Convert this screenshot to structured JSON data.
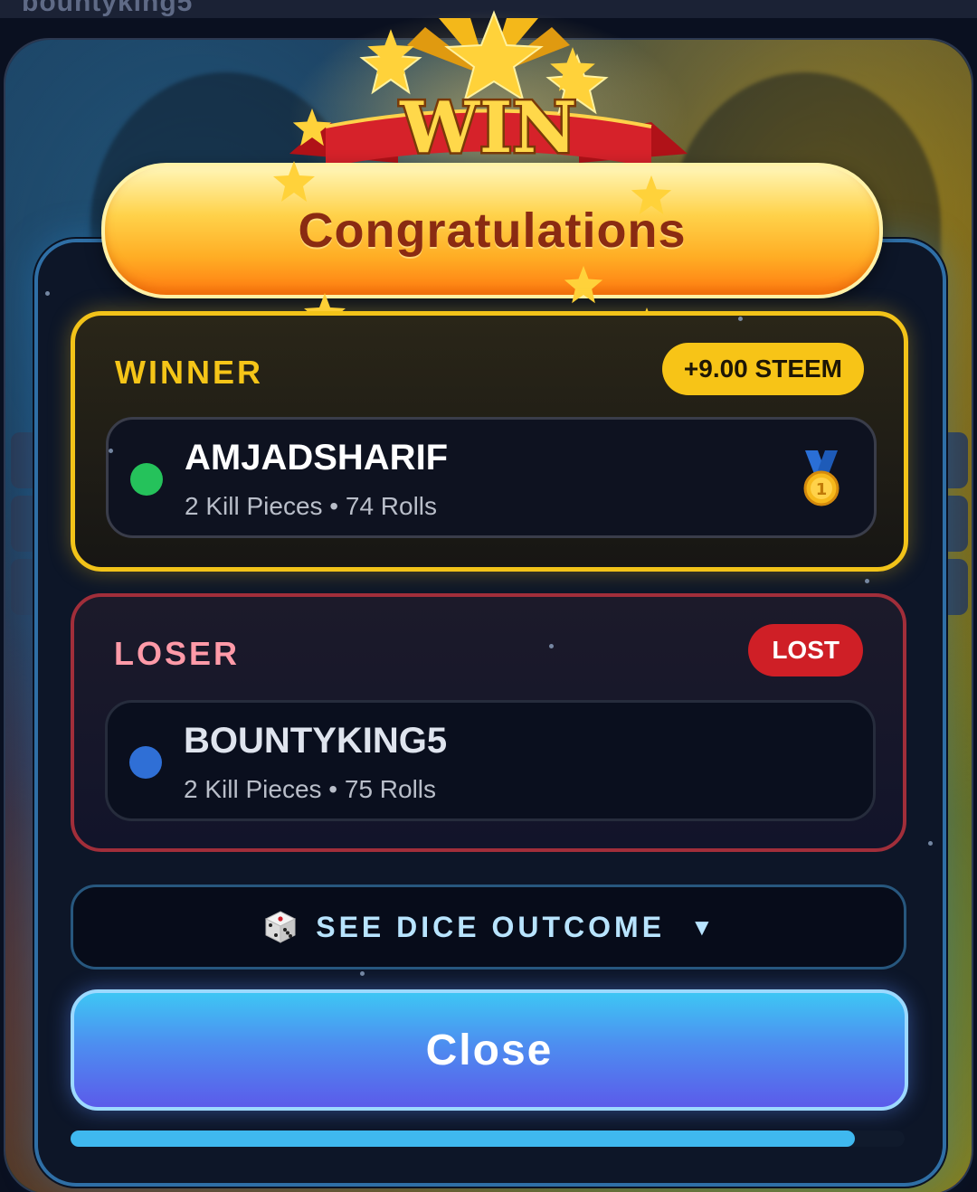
{
  "background": {
    "brand_text": "bountyking5"
  },
  "banner": {
    "win_text": "WIN",
    "congrats_text": "Congratulations"
  },
  "winner": {
    "label": "WINNER",
    "reward_badge": "+9.00 STEEM",
    "player_name": "AMJADSHARIF",
    "stats": "2 Kill Pieces • 74 Rolls",
    "status_color": "#25c25b",
    "medal_icon": "gold-medal-1st"
  },
  "loser": {
    "label": "LOSER",
    "status_badge": "LOST",
    "player_name": "BOUNTYKING5",
    "stats": "2 Kill Pieces • 75 Rolls",
    "status_color": "#2f6fd6"
  },
  "dice_button": {
    "icon": "dice-icon",
    "label": "SEE DICE OUTCOME",
    "caret": "▼"
  },
  "close_button": {
    "label": "Close"
  },
  "progress": {
    "fraction": 0.94
  },
  "colors": {
    "accent_gold": "#f5c518",
    "accent_red": "#cf1f26",
    "accent_blue": "#3fb8ef"
  }
}
